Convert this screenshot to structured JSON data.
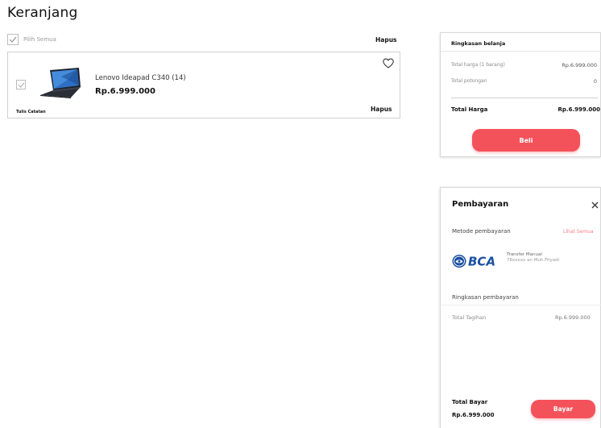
{
  "page": {
    "title": "Keranjang"
  },
  "cart": {
    "select_all_label": "Pilih Semua",
    "delete_all_label": "Hapus",
    "items": [
      {
        "name": "Lenovo Ideapad C340 (14)",
        "price": "Rp.6.999.000",
        "note_label": "Tulis Catatan",
        "delete_label": "Hapus",
        "checked": true,
        "image": "laptop-image"
      }
    ]
  },
  "summary": {
    "title": "Ringkasan belanja",
    "rows": [
      {
        "label": "Total harga (1 barang)",
        "value": "Rp.6.999.000"
      },
      {
        "label": "Total potongan",
        "value": "0"
      }
    ],
    "total_label": "Total Harga",
    "total_value": "Rp.6.999.000",
    "buy_label": "Beli"
  },
  "payment": {
    "title": "Pembayaran",
    "method_label": "Metode pembayaran",
    "see_all_label": "Lihat Semua",
    "bank": {
      "logo_text": "BCA",
      "line1": "Transfer Manual",
      "line2": "78xxxxx an Muh.Fityadi"
    },
    "summary_label": "Ringkasan pembayaran",
    "bill_label": "Total Tagihan",
    "bill_value": "Rp.6.999.000",
    "total_label": "Total Bayar",
    "total_value": "Rp.6.999.000",
    "pay_label": "Bayar"
  },
  "colors": {
    "accent": "#f4525b",
    "bca_blue": "#1a4fa0"
  },
  "icons": [
    "check-icon",
    "heart-icon",
    "close-icon",
    "bca-logo"
  ]
}
